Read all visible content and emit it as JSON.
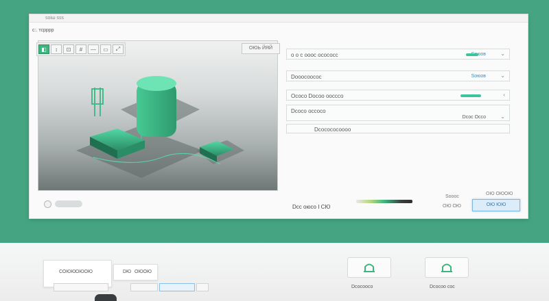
{
  "window": {
    "title": "ѕоіш ѕѕѕ",
    "menu_label": "c:. тсрррр"
  },
  "toolbar": {
    "tools": [
      {
        "icon": "select-icon",
        "glyph": "◧"
      },
      {
        "icon": "pin-icon",
        "glyph": "↕"
      },
      {
        "icon": "frame-icon",
        "glyph": "⊡"
      },
      {
        "icon": "hash-icon",
        "glyph": "#"
      },
      {
        "icon": "dash-icon",
        "glyph": "—"
      },
      {
        "icon": "image-icon",
        "glyph": "▭"
      },
      {
        "icon": "expand-icon",
        "glyph": "⤢"
      }
    ]
  },
  "viewport": {
    "button_label": "ОЮЬ ЙЯЙ"
  },
  "fields": [
    {
      "label": "о о  с ооос осососс",
      "value": "Ѕоюов",
      "chevron": "⌄"
    },
    {
      "label": "Dооосоосос",
      "value": "Ѕоюов",
      "chevron": "⌄"
    },
    {
      "label": "Ососо  Dосоо  оосссо",
      "value": "",
      "chevron": "‹"
    },
    {
      "label": "Dсосо  оссосо",
      "value": "Dсос  Оссо",
      "chevron": "⌄"
    },
    {
      "label": "Dсосососоооо",
      "value": "",
      "chevron": ""
    }
  ],
  "status": {
    "left_text": "Dсс оюсо  I СЮ",
    "right_top": "Ѕооос",
    "right_middle": "ОЮ  ОЮ",
    "right_upper": "ОЮ ОЮОЮ"
  },
  "primary_button": {
    "label": "ОЮ ЮЮ"
  },
  "lower": {
    "card_a_label": "СОЮЮ",
    "card_a_sub": "ОЮОЮ",
    "card_b_label": "DЮ",
    "card_b_sub": "ОЮОЮ",
    "icon_caption_a": "Dсосоосо",
    "icon_caption_b": "Dсосоо сос"
  },
  "colors": {
    "accent": "#3fb57e",
    "background_teal": "#45a583",
    "primary_blue": "#7ab6e2"
  }
}
